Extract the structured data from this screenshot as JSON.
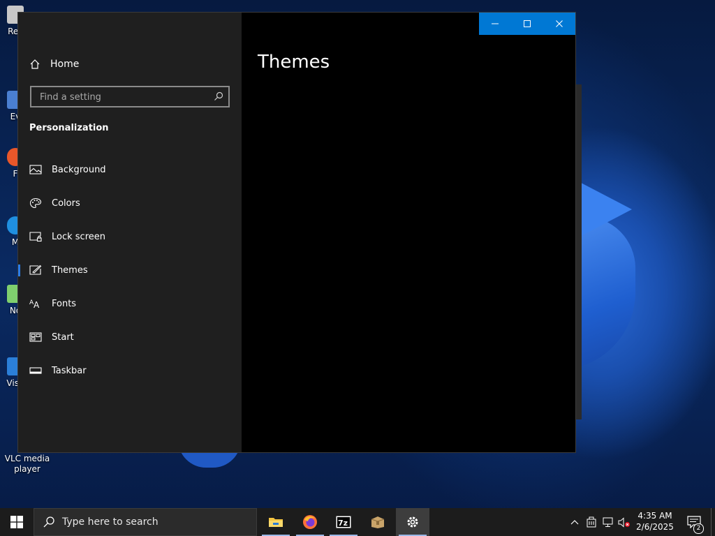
{
  "desktop": {
    "icons": [
      {
        "label": "Rec",
        "color": "#c8c8c8"
      },
      {
        "label": "Ev",
        "color": "#4a7fd1"
      },
      {
        "label": "F",
        "color": "#e8572a"
      },
      {
        "label": "M",
        "color": "#1f8fe0"
      },
      {
        "label": "No",
        "color": "#7fcf6e"
      },
      {
        "label": "Visu",
        "color": "#2b7fd8"
      },
      {
        "label": "VLC media player",
        "color": "#f08a18"
      }
    ]
  },
  "window": {
    "nav": {
      "home_label": "Home",
      "search_placeholder": "Find a setting",
      "section_title": "Personalization",
      "items": [
        {
          "label": "Background",
          "icon": "picture-icon"
        },
        {
          "label": "Colors",
          "icon": "palette-icon"
        },
        {
          "label": "Lock screen",
          "icon": "lock-screen-icon"
        },
        {
          "label": "Themes",
          "icon": "brush-icon",
          "selected": true
        },
        {
          "label": "Fonts",
          "icon": "fonts-icon"
        },
        {
          "label": "Start",
          "icon": "start-grid-icon"
        },
        {
          "label": "Taskbar",
          "icon": "taskbar-icon"
        }
      ]
    },
    "content": {
      "title": "Themes"
    },
    "controls": {
      "minimize": "minimize-icon",
      "maximize": "maximize-icon",
      "close": "close-icon"
    },
    "accent": "#0078d4"
  },
  "taskbar": {
    "search_placeholder": "Type here to search",
    "apps": [
      "file-explorer-icon",
      "firefox-icon",
      "7zip-icon",
      "package-icon",
      "settings-gear-icon"
    ],
    "tray": [
      "chevron-up-icon",
      "device-icon",
      "network-icon",
      "volume-muted-icon"
    ],
    "time": "4:35 AM",
    "date": "2/6/2025",
    "notification_count": "2"
  }
}
